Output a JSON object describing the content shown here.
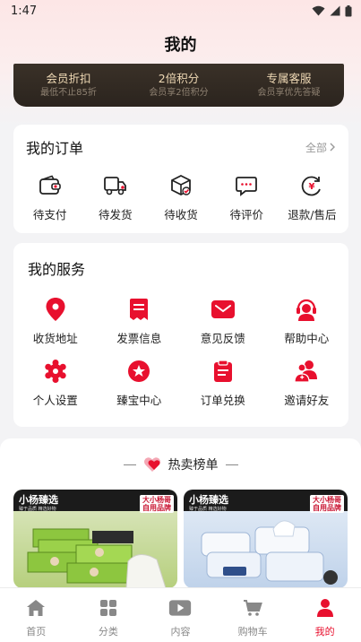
{
  "status_bar": {
    "time": "1:47"
  },
  "page_title": "我的",
  "vip_benefits": [
    {
      "title": "会员折扣",
      "subtitle": "最低不止85折"
    },
    {
      "title": "2倍积分",
      "subtitle": "会员享2倍积分"
    },
    {
      "title": "专属客服",
      "subtitle": "会员享优先答疑"
    }
  ],
  "orders": {
    "title": "我的订单",
    "all_label": "全部",
    "items": [
      {
        "label": "待支付",
        "icon": "wallet-icon"
      },
      {
        "label": "待发货",
        "icon": "truck-icon"
      },
      {
        "label": "待收货",
        "icon": "package-icon"
      },
      {
        "label": "待评价",
        "icon": "comment-icon"
      },
      {
        "label": "退款/售后",
        "icon": "refund-icon"
      }
    ]
  },
  "services": {
    "title": "我的服务",
    "items": [
      {
        "label": "收货地址",
        "icon": "location-pin-icon"
      },
      {
        "label": "发票信息",
        "icon": "invoice-icon"
      },
      {
        "label": "意见反馈",
        "icon": "mail-icon"
      },
      {
        "label": "帮助中心",
        "icon": "headset-icon"
      },
      {
        "label": "个人设置",
        "icon": "settings-icon"
      },
      {
        "label": "臻宝中心",
        "icon": "star-badge-icon"
      },
      {
        "label": "订单兑换",
        "icon": "clipboard-icon"
      },
      {
        "label": "邀请好友",
        "icon": "invite-friends-icon"
      }
    ]
  },
  "hot_list": {
    "title": "热卖榜单",
    "products": [
      {
        "brand": "小杨臻选",
        "brand_sub": "臻于品质 精选好物",
        "badge_line1": "大小杨哥",
        "badge_line2": "自用品牌"
      },
      {
        "brand": "小杨臻选",
        "brand_sub": "臻于品质 精选好物",
        "badge_line1": "大小杨哥",
        "badge_line2": "自用品牌"
      }
    ]
  },
  "tabbar": {
    "items": [
      {
        "label": "首页",
        "icon": "home-icon"
      },
      {
        "label": "分类",
        "icon": "category-icon"
      },
      {
        "label": "内容",
        "icon": "video-icon"
      },
      {
        "label": "购物车",
        "icon": "cart-icon"
      },
      {
        "label": "我的",
        "icon": "user-icon"
      }
    ],
    "active_index": 4
  },
  "colors": {
    "accent": "#e8102e",
    "vip_bg": "#2f2822",
    "vip_text": "#efd9b5"
  }
}
